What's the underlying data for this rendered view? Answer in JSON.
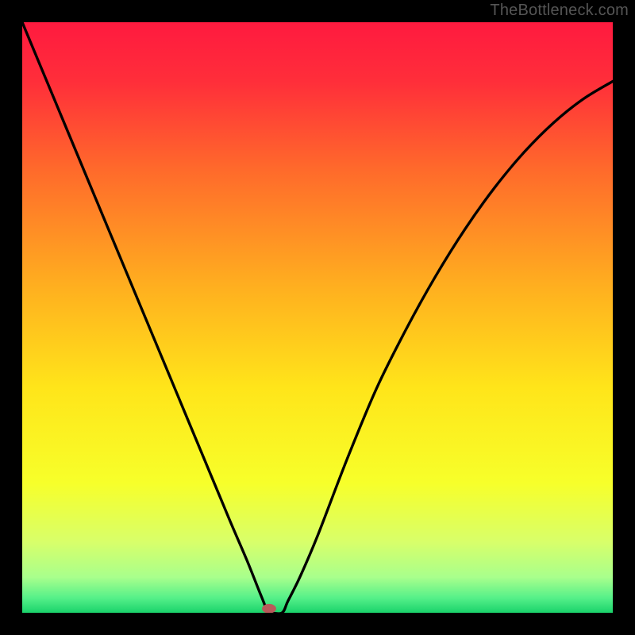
{
  "watermark": "TheBottleneck.com",
  "chart_data": {
    "type": "line",
    "title": "",
    "xlabel": "",
    "ylabel": "",
    "xlim": [
      0,
      1
    ],
    "ylim": [
      0,
      1
    ],
    "legend": false,
    "grid": false,
    "gradient_stops": [
      {
        "offset": 0.0,
        "color": "#ff1a3f"
      },
      {
        "offset": 0.1,
        "color": "#ff2e3a"
      },
      {
        "offset": 0.25,
        "color": "#ff6a2b"
      },
      {
        "offset": 0.45,
        "color": "#ffb01f"
      },
      {
        "offset": 0.62,
        "color": "#ffe51a"
      },
      {
        "offset": 0.78,
        "color": "#f7ff2a"
      },
      {
        "offset": 0.88,
        "color": "#d8ff6a"
      },
      {
        "offset": 0.94,
        "color": "#a8ff8c"
      },
      {
        "offset": 0.975,
        "color": "#55f089"
      },
      {
        "offset": 1.0,
        "color": "#1ad36b"
      }
    ],
    "series": [
      {
        "name": "bottleneck-curve",
        "x": [
          0.0,
          0.05,
          0.1,
          0.15,
          0.2,
          0.25,
          0.3,
          0.35,
          0.38,
          0.4,
          0.41,
          0.415,
          0.42,
          0.44,
          0.45,
          0.47,
          0.5,
          0.55,
          0.6,
          0.65,
          0.7,
          0.75,
          0.8,
          0.85,
          0.9,
          0.95,
          1.0
        ],
        "y": [
          1.0,
          0.88,
          0.76,
          0.64,
          0.52,
          0.4,
          0.28,
          0.16,
          0.09,
          0.04,
          0.015,
          0.0,
          0.0,
          0.0,
          0.02,
          0.06,
          0.13,
          0.26,
          0.38,
          0.48,
          0.57,
          0.65,
          0.72,
          0.78,
          0.83,
          0.87,
          0.9
        ]
      }
    ],
    "marker": {
      "x": 0.418,
      "y": 0.007,
      "color": "#b85a5a",
      "rx": 0.012,
      "ry": 0.008
    }
  }
}
